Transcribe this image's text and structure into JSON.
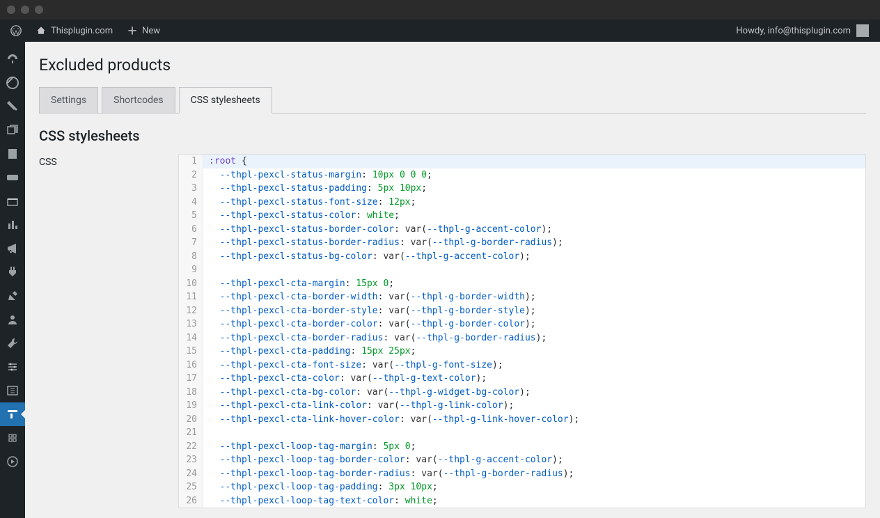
{
  "adminbar": {
    "site_name": "Thisplugin.com",
    "new_label": "New",
    "howdy_prefix": "Howdy, ",
    "user": "info@thisplugin.com"
  },
  "page": {
    "title": "Excluded products",
    "section_title": "CSS stylesheets",
    "field_label": "CSS"
  },
  "tabs": [
    {
      "label": "Settings",
      "active": false
    },
    {
      "label": "Shortcodes",
      "active": false
    },
    {
      "label": "CSS stylesheets",
      "active": true
    }
  ],
  "code_lines": [
    {
      "n": 1,
      "hl": true,
      "tokens": [
        [
          "sel",
          ":root"
        ],
        [
          "punc",
          " {"
        ]
      ]
    },
    {
      "n": 2,
      "tokens": [
        [
          "ind",
          "  "
        ],
        [
          "prop",
          "--thpl-pexcl-status-margin"
        ],
        [
          "punc",
          ": "
        ],
        [
          "num",
          "10px"
        ],
        [
          "punc",
          " "
        ],
        [
          "num",
          "0"
        ],
        [
          "punc",
          " "
        ],
        [
          "num",
          "0"
        ],
        [
          "punc",
          " "
        ],
        [
          "num",
          "0"
        ],
        [
          "punc",
          ";"
        ]
      ]
    },
    {
      "n": 3,
      "tokens": [
        [
          "ind",
          "  "
        ],
        [
          "prop",
          "--thpl-pexcl-status-padding"
        ],
        [
          "punc",
          ": "
        ],
        [
          "num",
          "5px"
        ],
        [
          "punc",
          " "
        ],
        [
          "num",
          "10px"
        ],
        [
          "punc",
          ";"
        ]
      ]
    },
    {
      "n": 4,
      "tokens": [
        [
          "ind",
          "  "
        ],
        [
          "prop",
          "--thpl-pexcl-status-font-size"
        ],
        [
          "punc",
          ": "
        ],
        [
          "num",
          "12px"
        ],
        [
          "punc",
          ";"
        ]
      ]
    },
    {
      "n": 5,
      "tokens": [
        [
          "ind",
          "  "
        ],
        [
          "prop",
          "--thpl-pexcl-status-color"
        ],
        [
          "punc",
          ": "
        ],
        [
          "kw",
          "white"
        ],
        [
          "punc",
          ";"
        ]
      ]
    },
    {
      "n": 6,
      "tokens": [
        [
          "ind",
          "  "
        ],
        [
          "prop",
          "--thpl-pexcl-status-border-color"
        ],
        [
          "punc",
          ": "
        ],
        [
          "func",
          "var"
        ],
        [
          "punc",
          "("
        ],
        [
          "var",
          "--thpl-g-accent-color"
        ],
        [
          "punc",
          ");"
        ]
      ]
    },
    {
      "n": 7,
      "tokens": [
        [
          "ind",
          "  "
        ],
        [
          "prop",
          "--thpl-pexcl-status-border-radius"
        ],
        [
          "punc",
          ": "
        ],
        [
          "func",
          "var"
        ],
        [
          "punc",
          "("
        ],
        [
          "var",
          "--thpl-g-border-radius"
        ],
        [
          "punc",
          ");"
        ]
      ]
    },
    {
      "n": 8,
      "tokens": [
        [
          "ind",
          "  "
        ],
        [
          "prop",
          "--thpl-pexcl-status-bg-color"
        ],
        [
          "punc",
          ": "
        ],
        [
          "func",
          "var"
        ],
        [
          "punc",
          "("
        ],
        [
          "var",
          "--thpl-g-accent-color"
        ],
        [
          "punc",
          ");"
        ]
      ]
    },
    {
      "n": 9,
      "tokens": []
    },
    {
      "n": 10,
      "tokens": [
        [
          "ind",
          "  "
        ],
        [
          "prop",
          "--thpl-pexcl-cta-margin"
        ],
        [
          "punc",
          ": "
        ],
        [
          "num",
          "15px"
        ],
        [
          "punc",
          " "
        ],
        [
          "num",
          "0"
        ],
        [
          "punc",
          ";"
        ]
      ]
    },
    {
      "n": 11,
      "tokens": [
        [
          "ind",
          "  "
        ],
        [
          "prop",
          "--thpl-pexcl-cta-border-width"
        ],
        [
          "punc",
          ": "
        ],
        [
          "func",
          "var"
        ],
        [
          "punc",
          "("
        ],
        [
          "var",
          "--thpl-g-border-width"
        ],
        [
          "punc",
          ");"
        ]
      ]
    },
    {
      "n": 12,
      "tokens": [
        [
          "ind",
          "  "
        ],
        [
          "prop",
          "--thpl-pexcl-cta-border-style"
        ],
        [
          "punc",
          ": "
        ],
        [
          "func",
          "var"
        ],
        [
          "punc",
          "("
        ],
        [
          "var",
          "--thpl-g-border-style"
        ],
        [
          "punc",
          ");"
        ]
      ]
    },
    {
      "n": 13,
      "tokens": [
        [
          "ind",
          "  "
        ],
        [
          "prop",
          "--thpl-pexcl-cta-border-color"
        ],
        [
          "punc",
          ": "
        ],
        [
          "func",
          "var"
        ],
        [
          "punc",
          "("
        ],
        [
          "var",
          "--thpl-g-border-color"
        ],
        [
          "punc",
          ");"
        ]
      ]
    },
    {
      "n": 14,
      "tokens": [
        [
          "ind",
          "  "
        ],
        [
          "prop",
          "--thpl-pexcl-cta-border-radius"
        ],
        [
          "punc",
          ": "
        ],
        [
          "func",
          "var"
        ],
        [
          "punc",
          "("
        ],
        [
          "var",
          "--thpl-g-border-radius"
        ],
        [
          "punc",
          ");"
        ]
      ]
    },
    {
      "n": 15,
      "tokens": [
        [
          "ind",
          "  "
        ],
        [
          "prop",
          "--thpl-pexcl-cta-padding"
        ],
        [
          "punc",
          ": "
        ],
        [
          "num",
          "15px"
        ],
        [
          "punc",
          " "
        ],
        [
          "num",
          "25px"
        ],
        [
          "punc",
          ";"
        ]
      ]
    },
    {
      "n": 16,
      "tokens": [
        [
          "ind",
          "  "
        ],
        [
          "prop",
          "--thpl-pexcl-cta-font-size"
        ],
        [
          "punc",
          ": "
        ],
        [
          "func",
          "var"
        ],
        [
          "punc",
          "("
        ],
        [
          "var",
          "--thpl-g-font-size"
        ],
        [
          "punc",
          ");"
        ]
      ]
    },
    {
      "n": 17,
      "tokens": [
        [
          "ind",
          "  "
        ],
        [
          "prop",
          "--thpl-pexcl-cta-color"
        ],
        [
          "punc",
          ": "
        ],
        [
          "func",
          "var"
        ],
        [
          "punc",
          "("
        ],
        [
          "var",
          "--thpl-g-text-color"
        ],
        [
          "punc",
          ");"
        ]
      ]
    },
    {
      "n": 18,
      "tokens": [
        [
          "ind",
          "  "
        ],
        [
          "prop",
          "--thpl-pexcl-cta-bg-color"
        ],
        [
          "punc",
          ": "
        ],
        [
          "func",
          "var"
        ],
        [
          "punc",
          "("
        ],
        [
          "var",
          "--thpl-g-widget-bg-color"
        ],
        [
          "punc",
          ");"
        ]
      ]
    },
    {
      "n": 19,
      "tokens": [
        [
          "ind",
          "  "
        ],
        [
          "prop",
          "--thpl-pexcl-cta-link-color"
        ],
        [
          "punc",
          ": "
        ],
        [
          "func",
          "var"
        ],
        [
          "punc",
          "("
        ],
        [
          "var",
          "--thpl-g-link-color"
        ],
        [
          "punc",
          ");"
        ]
      ]
    },
    {
      "n": 20,
      "tokens": [
        [
          "ind",
          "  "
        ],
        [
          "prop",
          "--thpl-pexcl-cta-link-hover-color"
        ],
        [
          "punc",
          ": "
        ],
        [
          "func",
          "var"
        ],
        [
          "punc",
          "("
        ],
        [
          "var",
          "--thpl-g-link-hover-color"
        ],
        [
          "punc",
          ");"
        ]
      ]
    },
    {
      "n": 21,
      "tokens": []
    },
    {
      "n": 22,
      "tokens": [
        [
          "ind",
          "  "
        ],
        [
          "prop",
          "--thpl-pexcl-loop-tag-margin"
        ],
        [
          "punc",
          ": "
        ],
        [
          "num",
          "5px"
        ],
        [
          "punc",
          " "
        ],
        [
          "num",
          "0"
        ],
        [
          "punc",
          ";"
        ]
      ]
    },
    {
      "n": 23,
      "tokens": [
        [
          "ind",
          "  "
        ],
        [
          "prop",
          "--thpl-pexcl-loop-tag-border-color"
        ],
        [
          "punc",
          ": "
        ],
        [
          "func",
          "var"
        ],
        [
          "punc",
          "("
        ],
        [
          "var",
          "--thpl-g-accent-color"
        ],
        [
          "punc",
          ");"
        ]
      ]
    },
    {
      "n": 24,
      "tokens": [
        [
          "ind",
          "  "
        ],
        [
          "prop",
          "--thpl-pexcl-loop-tag-border-radius"
        ],
        [
          "punc",
          ": "
        ],
        [
          "func",
          "var"
        ],
        [
          "punc",
          "("
        ],
        [
          "var",
          "--thpl-g-border-radius"
        ],
        [
          "punc",
          ");"
        ]
      ]
    },
    {
      "n": 25,
      "tokens": [
        [
          "ind",
          "  "
        ],
        [
          "prop",
          "--thpl-pexcl-loop-tag-padding"
        ],
        [
          "punc",
          ": "
        ],
        [
          "num",
          "3px"
        ],
        [
          "punc",
          " "
        ],
        [
          "num",
          "10px"
        ],
        [
          "punc",
          ";"
        ]
      ]
    },
    {
      "n": 26,
      "tokens": [
        [
          "ind",
          "  "
        ],
        [
          "prop",
          "--thpl-pexcl-loop-tag-text-color"
        ],
        [
          "punc",
          ": "
        ],
        [
          "kw",
          "white"
        ],
        [
          "punc",
          ";"
        ]
      ]
    }
  ],
  "sidebar_icons": [
    "dashboard",
    "site-updates",
    "pin",
    "media",
    "pages",
    "woocommerce",
    "cart",
    "analytics",
    "marketing",
    "plugins",
    "appearance",
    "users",
    "tools",
    "settings",
    "elementor",
    "thisplugin",
    "collapse",
    "other"
  ]
}
